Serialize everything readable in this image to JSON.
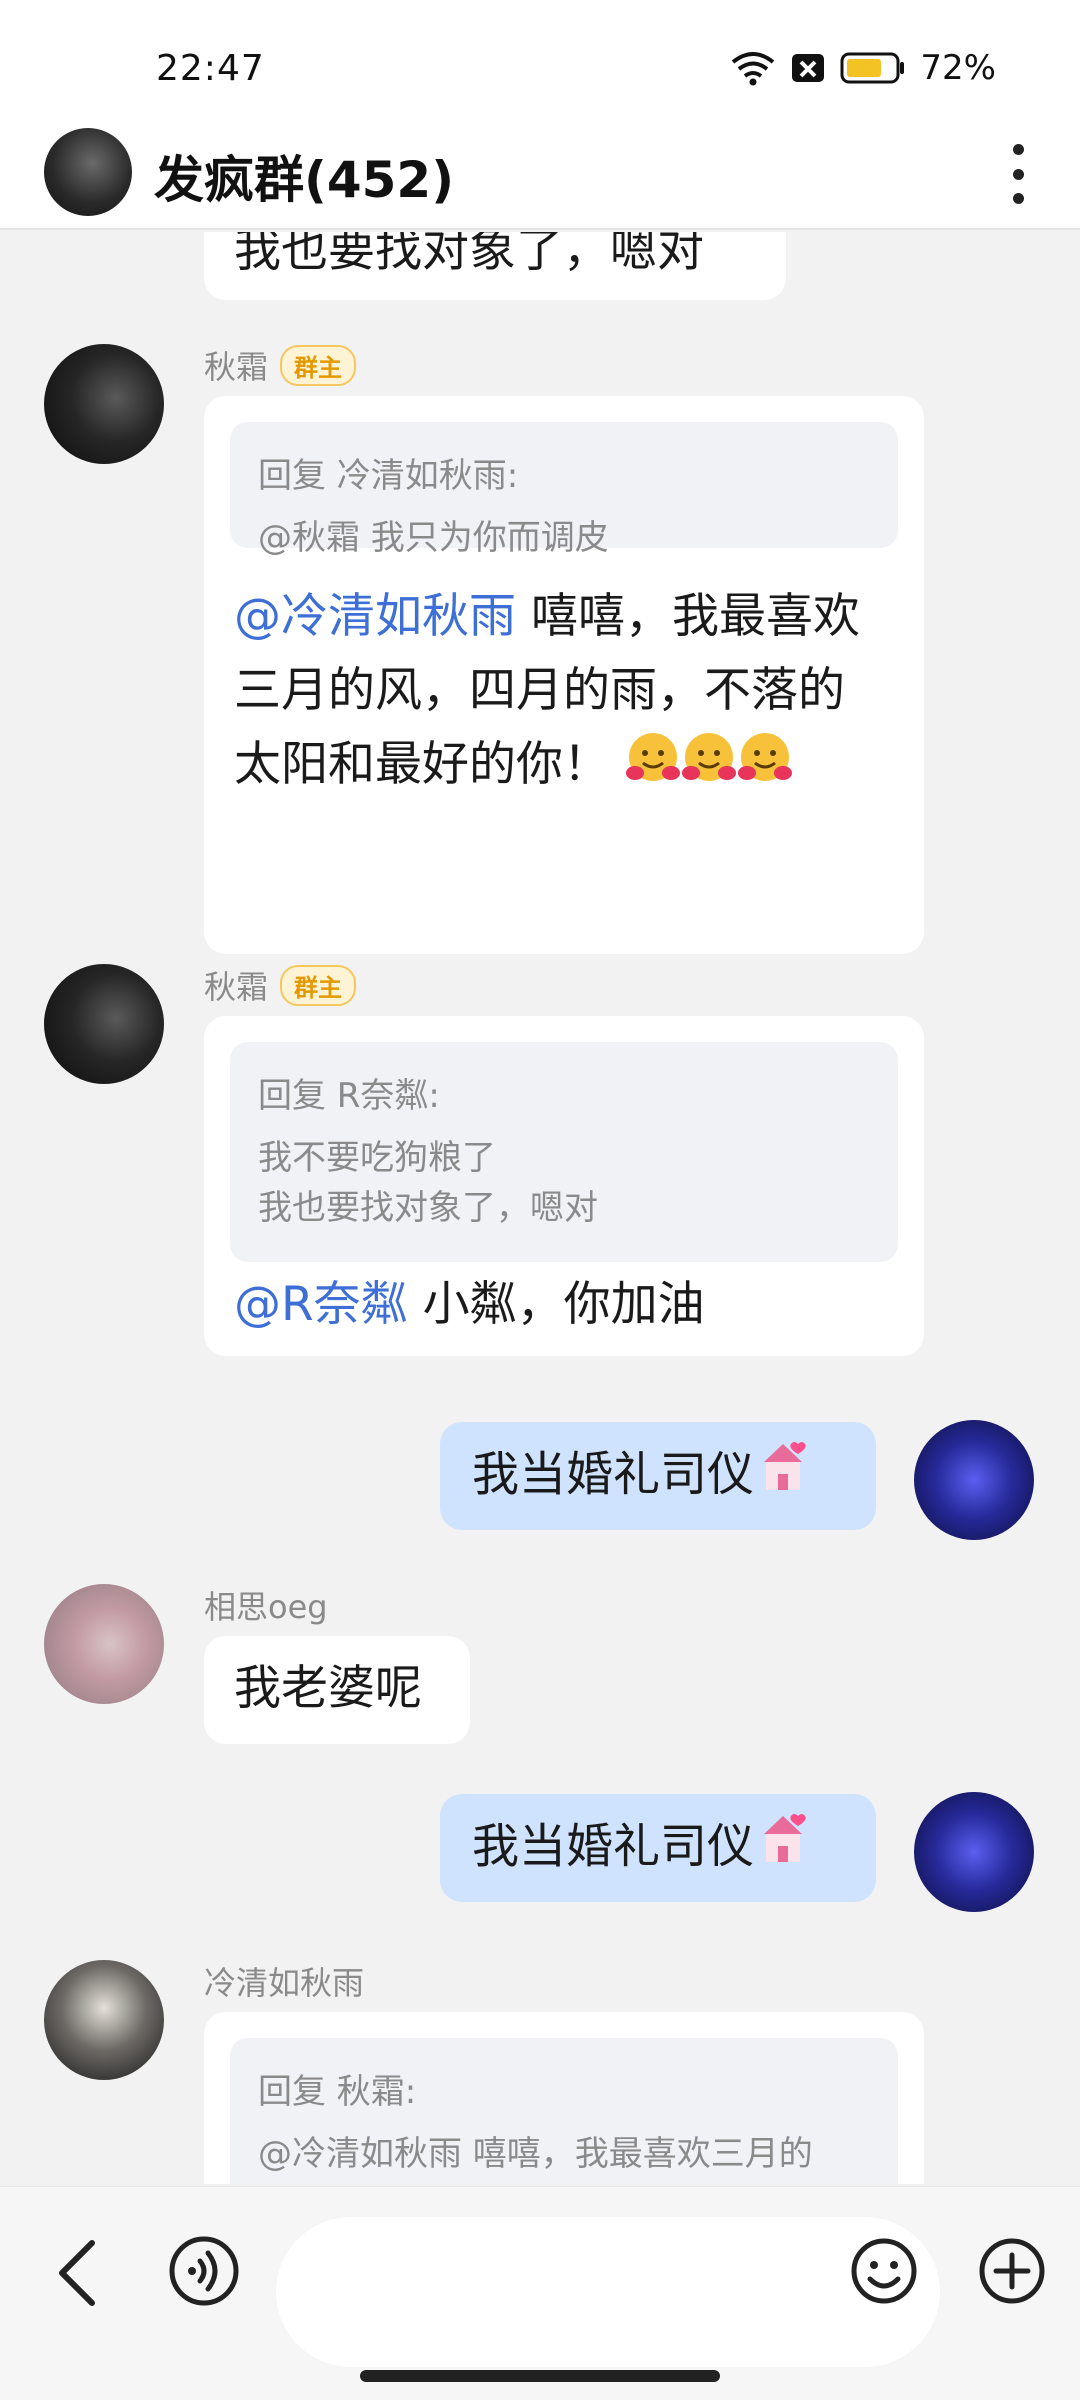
{
  "status_bar": {
    "time": "22:47",
    "battery": "72%"
  },
  "header": {
    "title": "发疯群(452)"
  },
  "messages": {
    "top_partial": {
      "text": "我也要找对象了，嗯对"
    },
    "m1": {
      "sender": "秋霜",
      "badge": "群主",
      "quote_title": "回复 冷清如秋雨:",
      "quote_text": "@秋霜 我只为你而调皮",
      "mention": "@冷清如秋雨",
      "text": " 嘻嘻，我最喜欢三月的风，四月的雨，不落的太阳和最好的你！"
    },
    "m2": {
      "sender": "秋霜",
      "badge": "群主",
      "quote_title": "回复 R奈粼:",
      "quote_text": "我不要吃狗粮了\n我也要找对象了，嗯对",
      "mention": "@R奈粼",
      "text": " 小粼，你加油"
    },
    "m3": {
      "text": "我当婚礼司仪"
    },
    "m4": {
      "sender": "相思oeg",
      "text": "我老婆呢"
    },
    "m5": {
      "text": "我当婚礼司仪"
    },
    "m6": {
      "sender": "冷清如秋雨",
      "quote_title": "回复 秋霜:",
      "quote_text": "@冷清如秋雨 嘻嘻，我最喜欢三月的"
    }
  },
  "input": {
    "placeholder": ""
  },
  "icons": {
    "back": "chevron-left-icon",
    "voice": "voice-icon",
    "emoji": "smiley-icon",
    "plus": "plus-circle-icon",
    "more": "more-vertical-icon",
    "wifi": "wifi-icon",
    "notification": "notification-icon",
    "battery": "battery-icon",
    "hug_emoji": "hugging-face-emoji",
    "wedding_emoji": "wedding-chapel-emoji"
  },
  "colors": {
    "mention": "#3d6fd6",
    "my_bubble": "#cfe3ff",
    "badge": "#e39a00"
  }
}
